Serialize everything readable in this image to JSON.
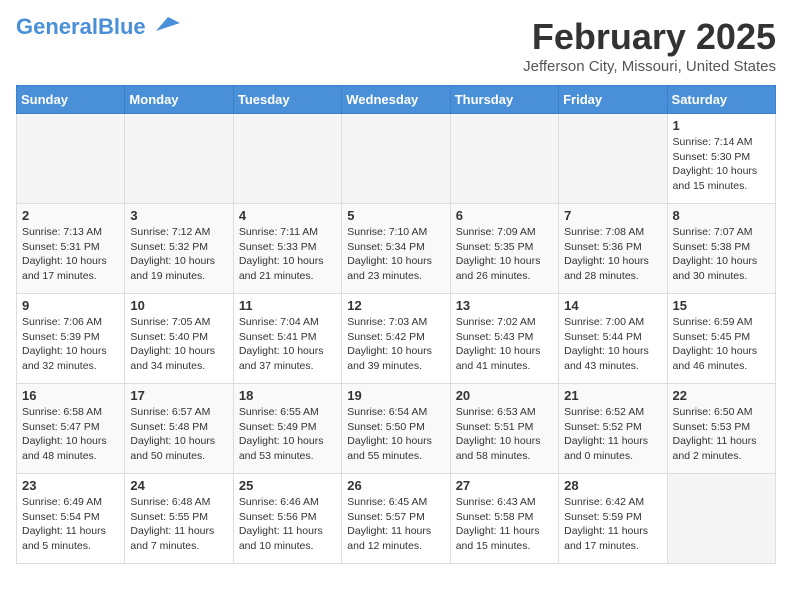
{
  "header": {
    "logo_general": "General",
    "logo_blue": "Blue",
    "month_title": "February 2025",
    "location": "Jefferson City, Missouri, United States"
  },
  "weekdays": [
    "Sunday",
    "Monday",
    "Tuesday",
    "Wednesday",
    "Thursday",
    "Friday",
    "Saturday"
  ],
  "weeks": [
    [
      {
        "day": "",
        "info": ""
      },
      {
        "day": "",
        "info": ""
      },
      {
        "day": "",
        "info": ""
      },
      {
        "day": "",
        "info": ""
      },
      {
        "day": "",
        "info": ""
      },
      {
        "day": "",
        "info": ""
      },
      {
        "day": "1",
        "info": "Sunrise: 7:14 AM\nSunset: 5:30 PM\nDaylight: 10 hours and 15 minutes."
      }
    ],
    [
      {
        "day": "2",
        "info": "Sunrise: 7:13 AM\nSunset: 5:31 PM\nDaylight: 10 hours and 17 minutes."
      },
      {
        "day": "3",
        "info": "Sunrise: 7:12 AM\nSunset: 5:32 PM\nDaylight: 10 hours and 19 minutes."
      },
      {
        "day": "4",
        "info": "Sunrise: 7:11 AM\nSunset: 5:33 PM\nDaylight: 10 hours and 21 minutes."
      },
      {
        "day": "5",
        "info": "Sunrise: 7:10 AM\nSunset: 5:34 PM\nDaylight: 10 hours and 23 minutes."
      },
      {
        "day": "6",
        "info": "Sunrise: 7:09 AM\nSunset: 5:35 PM\nDaylight: 10 hours and 26 minutes."
      },
      {
        "day": "7",
        "info": "Sunrise: 7:08 AM\nSunset: 5:36 PM\nDaylight: 10 hours and 28 minutes."
      },
      {
        "day": "8",
        "info": "Sunrise: 7:07 AM\nSunset: 5:38 PM\nDaylight: 10 hours and 30 minutes."
      }
    ],
    [
      {
        "day": "9",
        "info": "Sunrise: 7:06 AM\nSunset: 5:39 PM\nDaylight: 10 hours and 32 minutes."
      },
      {
        "day": "10",
        "info": "Sunrise: 7:05 AM\nSunset: 5:40 PM\nDaylight: 10 hours and 34 minutes."
      },
      {
        "day": "11",
        "info": "Sunrise: 7:04 AM\nSunset: 5:41 PM\nDaylight: 10 hours and 37 minutes."
      },
      {
        "day": "12",
        "info": "Sunrise: 7:03 AM\nSunset: 5:42 PM\nDaylight: 10 hours and 39 minutes."
      },
      {
        "day": "13",
        "info": "Sunrise: 7:02 AM\nSunset: 5:43 PM\nDaylight: 10 hours and 41 minutes."
      },
      {
        "day": "14",
        "info": "Sunrise: 7:00 AM\nSunset: 5:44 PM\nDaylight: 10 hours and 43 minutes."
      },
      {
        "day": "15",
        "info": "Sunrise: 6:59 AM\nSunset: 5:45 PM\nDaylight: 10 hours and 46 minutes."
      }
    ],
    [
      {
        "day": "16",
        "info": "Sunrise: 6:58 AM\nSunset: 5:47 PM\nDaylight: 10 hours and 48 minutes."
      },
      {
        "day": "17",
        "info": "Sunrise: 6:57 AM\nSunset: 5:48 PM\nDaylight: 10 hours and 50 minutes."
      },
      {
        "day": "18",
        "info": "Sunrise: 6:55 AM\nSunset: 5:49 PM\nDaylight: 10 hours and 53 minutes."
      },
      {
        "day": "19",
        "info": "Sunrise: 6:54 AM\nSunset: 5:50 PM\nDaylight: 10 hours and 55 minutes."
      },
      {
        "day": "20",
        "info": "Sunrise: 6:53 AM\nSunset: 5:51 PM\nDaylight: 10 hours and 58 minutes."
      },
      {
        "day": "21",
        "info": "Sunrise: 6:52 AM\nSunset: 5:52 PM\nDaylight: 11 hours and 0 minutes."
      },
      {
        "day": "22",
        "info": "Sunrise: 6:50 AM\nSunset: 5:53 PM\nDaylight: 11 hours and 2 minutes."
      }
    ],
    [
      {
        "day": "23",
        "info": "Sunrise: 6:49 AM\nSunset: 5:54 PM\nDaylight: 11 hours and 5 minutes."
      },
      {
        "day": "24",
        "info": "Sunrise: 6:48 AM\nSunset: 5:55 PM\nDaylight: 11 hours and 7 minutes."
      },
      {
        "day": "25",
        "info": "Sunrise: 6:46 AM\nSunset: 5:56 PM\nDaylight: 11 hours and 10 minutes."
      },
      {
        "day": "26",
        "info": "Sunrise: 6:45 AM\nSunset: 5:57 PM\nDaylight: 11 hours and 12 minutes."
      },
      {
        "day": "27",
        "info": "Sunrise: 6:43 AM\nSunset: 5:58 PM\nDaylight: 11 hours and 15 minutes."
      },
      {
        "day": "28",
        "info": "Sunrise: 6:42 AM\nSunset: 5:59 PM\nDaylight: 11 hours and 17 minutes."
      },
      {
        "day": "",
        "info": ""
      }
    ]
  ]
}
